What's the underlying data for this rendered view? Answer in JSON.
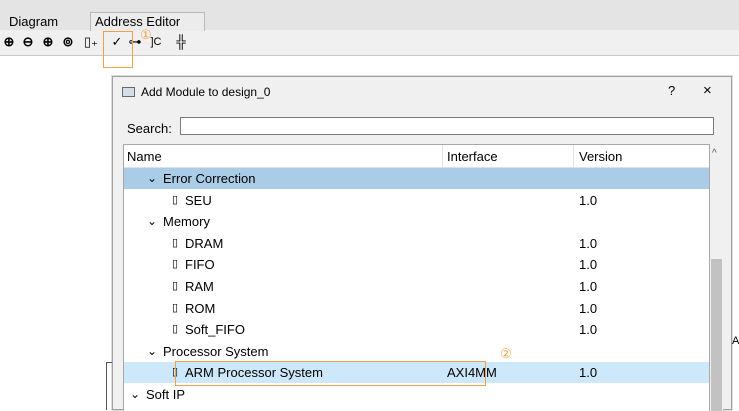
{
  "tabs": [
    "Diagram",
    "Address Editor"
  ],
  "toolbar": [
    {
      "icon": "zoom-in-icon",
      "glyph": "⊕"
    },
    {
      "icon": "zoom-out-icon",
      "glyph": "⊖"
    },
    {
      "icon": "zoom-fit-icon",
      "glyph": "⊕"
    },
    {
      "icon": "zoom-area-icon",
      "glyph": "⊚"
    },
    {
      "icon": "add-ip-icon",
      "glyph": "▯₊"
    },
    {
      "icon": "validate-icon",
      "glyph": "✓"
    },
    {
      "icon": "auto-connect-icon",
      "glyph": "⊶"
    },
    {
      "icon": "regenerate-layout-icon",
      "glyph": "]C"
    },
    {
      "icon": "pin-icon",
      "glyph": "╬"
    }
  ],
  "annotations": {
    "one": "①",
    "two": "②"
  },
  "dialog": {
    "title": "Add Module to design_0",
    "help": "?",
    "close": "×",
    "search_label": "Search:",
    "search_value": "",
    "columns": {
      "name": "Name",
      "interface": "Interface",
      "version": "Version"
    },
    "rows": [
      {
        "indent": 1,
        "expander": "⌄",
        "name": "Error Correction",
        "interface": "",
        "version": "",
        "state": "selected"
      },
      {
        "indent": 2,
        "expander": "▯",
        "name": "SEU",
        "interface": "",
        "version": "1.0",
        "state": ""
      },
      {
        "indent": 1,
        "expander": "⌄",
        "name": "Memory",
        "interface": "",
        "version": "",
        "state": ""
      },
      {
        "indent": 2,
        "expander": "▯",
        "name": "DRAM",
        "interface": "",
        "version": "1.0",
        "state": ""
      },
      {
        "indent": 2,
        "expander": "▯",
        "name": "FIFO",
        "interface": "",
        "version": "1.0",
        "state": ""
      },
      {
        "indent": 2,
        "expander": "▯",
        "name": "RAM",
        "interface": "",
        "version": "1.0",
        "state": ""
      },
      {
        "indent": 2,
        "expander": "▯",
        "name": "ROM",
        "interface": "",
        "version": "1.0",
        "state": ""
      },
      {
        "indent": 2,
        "expander": "▯",
        "name": "Soft_FIFO",
        "interface": "",
        "version": "1.0",
        "state": ""
      },
      {
        "indent": 1,
        "expander": "⌄",
        "name": "Processor System",
        "interface": "",
        "version": "",
        "state": ""
      },
      {
        "indent": 2,
        "expander": "▯",
        "name": "ARM Processor System",
        "interface": "AXI4MM",
        "version": "1.0",
        "state": "highlighted"
      },
      {
        "indent": 0,
        "expander": "⌄",
        "name": "Soft IP",
        "interface": "",
        "version": "",
        "state": ""
      }
    ],
    "scroll_up": "^"
  },
  "edge_fragment": "A"
}
